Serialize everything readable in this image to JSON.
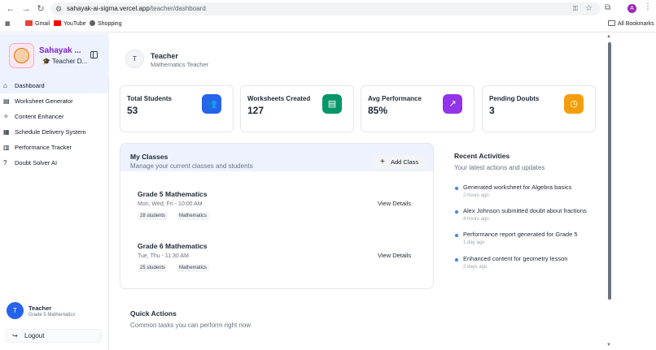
{
  "browser": {
    "url_host": "sahayak-ai-sigma.vercel.app",
    "url_path": "/teacher/dashboard",
    "profile_initial": "A",
    "bookmarks": [
      "Gmail",
      "YouTube",
      "Shopping"
    ],
    "all_bookmarks": "All Bookmarks"
  },
  "sidebar": {
    "brand_title": "Sahayak ...",
    "brand_sub": "Teacher D...",
    "items": [
      {
        "label": "Dashboard",
        "icon": "house-icon"
      },
      {
        "label": "Worksheet Generator",
        "icon": "document-icon"
      },
      {
        "label": "Content Enhancer",
        "icon": "sparkles-icon"
      },
      {
        "label": "Schedule Delivery System",
        "icon": "calendar-icon"
      },
      {
        "label": "Performance Tracker",
        "icon": "bar-chart-icon"
      },
      {
        "label": "Doubt Solver AI",
        "icon": "question-icon"
      }
    ],
    "user": {
      "initial": "T",
      "name": "Teacher",
      "role": "Grade 5 Mathematics"
    },
    "logout": "Logout"
  },
  "header": {
    "initial": "T",
    "name": "Teacher",
    "role": "Mathematics Teacher"
  },
  "stats": [
    {
      "label": "Total Students",
      "value": "53",
      "color": "#2563eb"
    },
    {
      "label": "Worksheets Created",
      "value": "127",
      "color": "#059669"
    },
    {
      "label": "Avg Performance",
      "value": "85%",
      "color": "#9333ea"
    },
    {
      "label": "Pending Doubts",
      "value": "3",
      "color": "#f59e0b"
    }
  ],
  "classes": {
    "title": "My Classes",
    "subtitle": "Manage your current classes and students",
    "add_label": "Add Class",
    "view_label": "View Details",
    "items": [
      {
        "name": "Grade 5 Mathematics",
        "schedule": "Mon, Wed, Fri - 10:00 AM",
        "students": "28 students",
        "subject": "Mathematics"
      },
      {
        "name": "Grade 6 Mathematics",
        "schedule": "Tue, Thu - 11:30 AM",
        "students": "25 students",
        "subject": "Mathematics"
      }
    ]
  },
  "activities": {
    "title": "Recent Activities",
    "subtitle": "Your latest actions and updates",
    "items": [
      {
        "text": "Generated worksheet for Algebra basics",
        "time": "2 hours ago"
      },
      {
        "text": "Alex Johnson submitted doubt about fractions",
        "time": "4 hours ago"
      },
      {
        "text": "Performance report generated for Grade 5",
        "time": "1 day ago"
      },
      {
        "text": "Enhanced content for geometry lesson",
        "time": "2 days ago"
      }
    ]
  },
  "quick_actions": {
    "title": "Quick Actions",
    "subtitle": "Common tasks you can perform right now"
  }
}
